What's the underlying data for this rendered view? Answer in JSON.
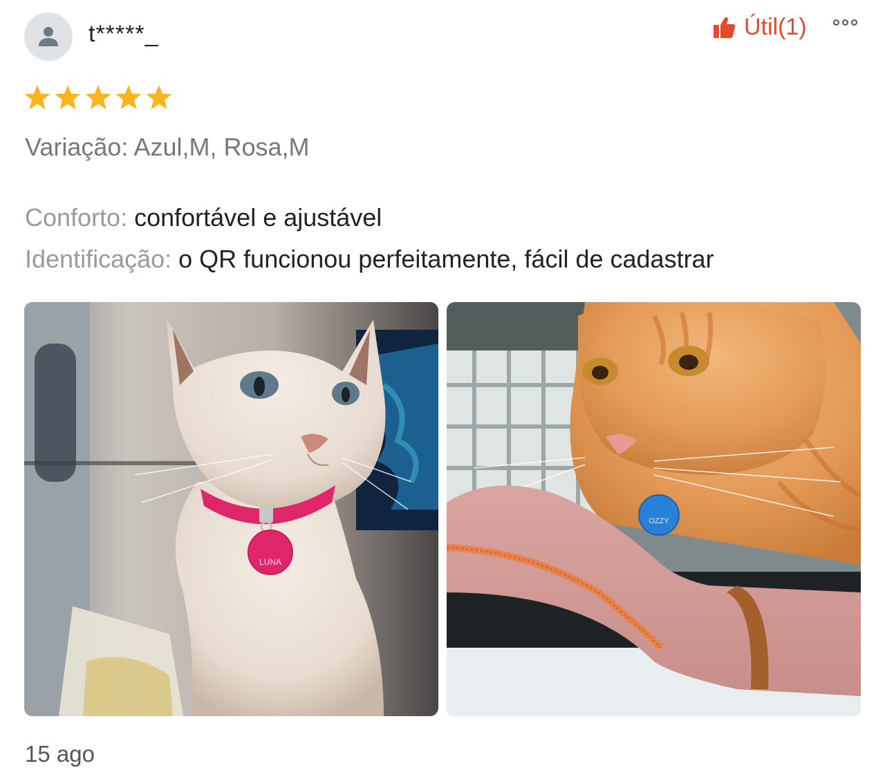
{
  "review": {
    "username": "t*****_",
    "rating": 5,
    "rating_max": 5,
    "helpful_label": "Útil(1)",
    "variation": "Variação: Azul,M, Rosa,M",
    "attributes": [
      {
        "key": "Conforto: ",
        "value": "confortável e ajustável"
      },
      {
        "key": "Identificação: ",
        "value": "o QR funcionou perfeitamente, fácil de cadastrar"
      }
    ],
    "photos": [
      {
        "tag_text": "LUNA"
      },
      {
        "tag_text": "OZZY"
      }
    ],
    "date": "15 ago"
  },
  "icons": {
    "avatar": "user-icon",
    "helpful": "thumbs-up-icon",
    "more": "more-options-icon",
    "star": "star-icon"
  },
  "colors": {
    "accent": "#e8492d",
    "star": "#fbb41c",
    "avatar_bg": "#dfe3e6",
    "muted_text": "#9a9a9a",
    "body_text": "#222222"
  }
}
